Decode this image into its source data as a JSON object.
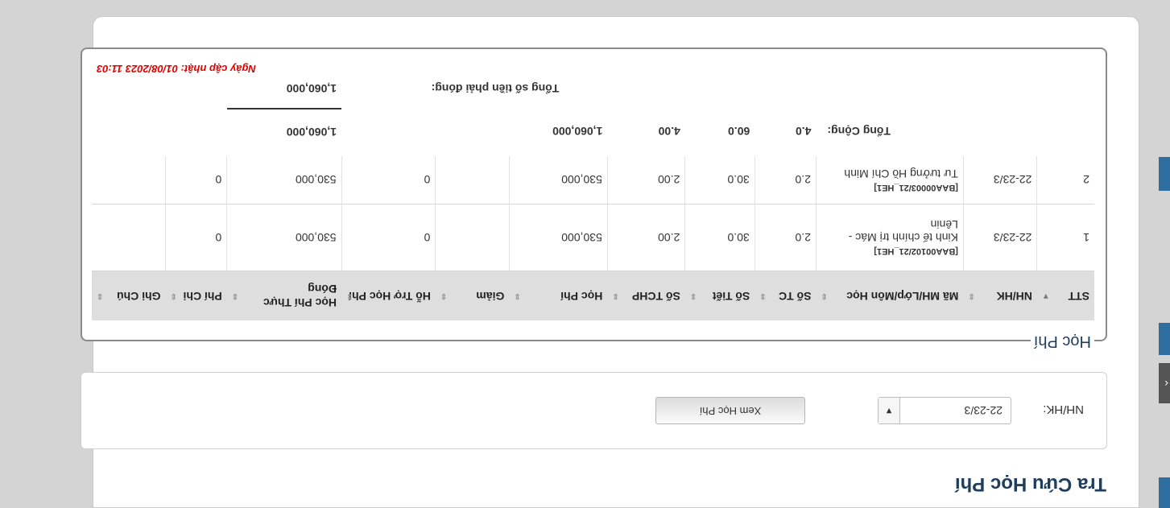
{
  "page": {
    "title": "Tra Cứu Học Phí"
  },
  "filter": {
    "label": "NH/HK:",
    "selected_value": "22-23/3",
    "dropdown_arrow": "▼",
    "view_button": "Xem Học Phí"
  },
  "fees": {
    "panel_title": "Học Phí",
    "columns": [
      "STT",
      "NH/HK",
      "Mã MH/Lớp/Môn Học",
      "Số TC",
      "Số Tiết",
      "Số TCHP",
      "Học Phí",
      "Giảm",
      "Hỗ Trợ Học Phí",
      "Học Phí Thực Đóng",
      "Phí Chi",
      "Ghi Chú"
    ],
    "rows": [
      {
        "stt": "1",
        "term": "22-23/3",
        "code": "[BAA00102/21_HE1]",
        "name": "Kinh tế chính trị Mác - Lênin",
        "tc": "2.0",
        "tiet": "30.0",
        "tchp": "2.00",
        "fee": "530,000",
        "discount": "",
        "support": "0",
        "paid": "530,000",
        "other": "0",
        "note": ""
      },
      {
        "stt": "2",
        "term": "22-23/3",
        "code": "[BAA00003/21_HE1]",
        "name": "Tư tưởng Hồ Chí Minh",
        "tc": "2.0",
        "tiet": "30.0",
        "tchp": "2.00",
        "fee": "530,000",
        "discount": "",
        "support": "0",
        "paid": "530,000",
        "other": "0",
        "note": ""
      }
    ],
    "total": {
      "label": "Tổng Cộng:",
      "tc": "4.0",
      "tiet": "60.0",
      "tchp": "4.00",
      "fee": "1,060,000",
      "paid": "1,060,000"
    },
    "amount_due": {
      "label": "Tổng số tiền phải đóng:",
      "value": "1,060,000"
    },
    "updated_at": "Ngày cập nhật: 01/08/2023 11:03"
  },
  "colors": {
    "accent": "#1f3d5c",
    "sidebar": "#2f6fa0",
    "updated_text": "#e00000"
  }
}
